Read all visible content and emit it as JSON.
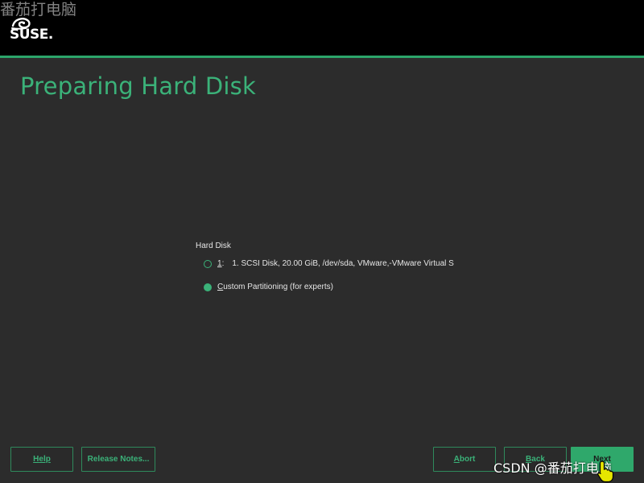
{
  "watermark_top": "番茄打电脑",
  "brand": {
    "logo_text": "SUSE."
  },
  "page": {
    "title": "Preparing Hard Disk"
  },
  "content": {
    "group_label": "Hard Disk",
    "options": [
      {
        "hotkey": "1",
        "index_suffix": ":",
        "label": "1. SCSI Disk, 20.00 GiB, /dev/sda, VMware,-VMware Virtual S",
        "selected": false
      },
      {
        "hotkey": "C",
        "label_rest": "ustom Partitioning (for experts)",
        "selected": true
      }
    ]
  },
  "buttons": {
    "help": {
      "hotkey": "H",
      "rest": "elp"
    },
    "release_notes": {
      "label": "Release Notes..."
    },
    "abort": {
      "hotkey": "A",
      "rest": "bort"
    },
    "back": {
      "hotkey": "B",
      "rest": "ack"
    },
    "next": {
      "label": "Next"
    }
  },
  "watermark_bottom": "CSDN @番茄打电脑",
  "colors": {
    "accent": "#3bb279",
    "header_bg": "#000000",
    "body_bg": "#2c2c2c"
  },
  "icons": {
    "logo": "chameleon-icon",
    "cursor": "hand-pointer-icon"
  }
}
